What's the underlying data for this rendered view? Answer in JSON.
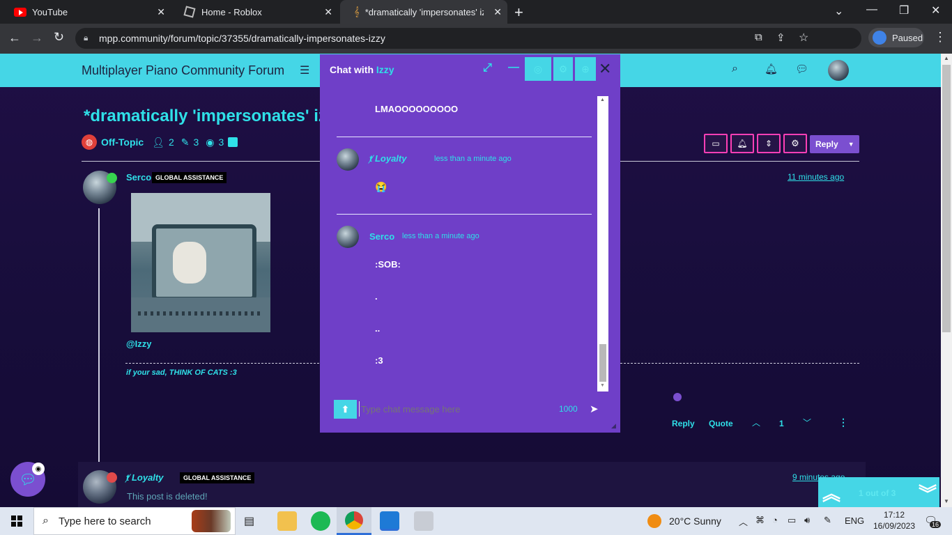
{
  "browser": {
    "tabs": [
      {
        "title": "YouTube",
        "icon": "youtube-icon"
      },
      {
        "title": "Home - Roblox",
        "icon": "roblox-icon"
      },
      {
        "title": "*dramatically 'impersonates' izzy",
        "icon": "mpp-icon"
      }
    ],
    "url": "mpp.community/forum/topic/37355/dramatically-impersonates-izzy",
    "profile_status": "Paused"
  },
  "forum": {
    "site_title": "Multiplayer Piano Community Forum",
    "topic_title": "*dramatically 'impersonates' izzy",
    "category": "Off-Topic",
    "stats": {
      "posters": "2",
      "posts": "3",
      "views": "3"
    },
    "reply_label": "Reply",
    "posts": [
      {
        "author": "Serco",
        "badge": "GLOBAL ASSISTANCE",
        "time": "11 minutes ago",
        "mention": "@Izzy",
        "signature": "if your sad, THINK OF CATS :3",
        "reply_label": "Reply",
        "quote_label": "Quote",
        "votes": "1"
      },
      {
        "author": "Loyalty",
        "badge": "GLOBAL ASSISTANCE",
        "time": "9 minutes ago",
        "body": "This post is deleted!"
      }
    ],
    "pagination": "1 out of 3"
  },
  "chat": {
    "title_prefix": "Chat with",
    "partner": "Izzy",
    "messages": [
      {
        "text": "LMAOOOOOOOOO"
      },
      {
        "author": "Loyalty",
        "time": "less than a minute ago",
        "text": "😭"
      },
      {
        "author": "Serco",
        "time": "less than a minute ago",
        "lines": [
          ":SOB:",
          ".",
          "..",
          ":3"
        ]
      }
    ],
    "input_placeholder": "Type chat message here",
    "char_count": "1000"
  },
  "taskbar": {
    "search_placeholder": "Type here to search",
    "weather": "20°C  Sunny",
    "language": "ENG",
    "time": "17:12",
    "date": "16/09/2023",
    "notifications": "16"
  },
  "colors": {
    "accent_cyan": "#2fe0e8",
    "chat_purple": "#6f3fc8",
    "header_cyan": "#45d6e6",
    "pink_border": "#ff3fb6",
    "reply_purple": "#7b4fd0"
  }
}
